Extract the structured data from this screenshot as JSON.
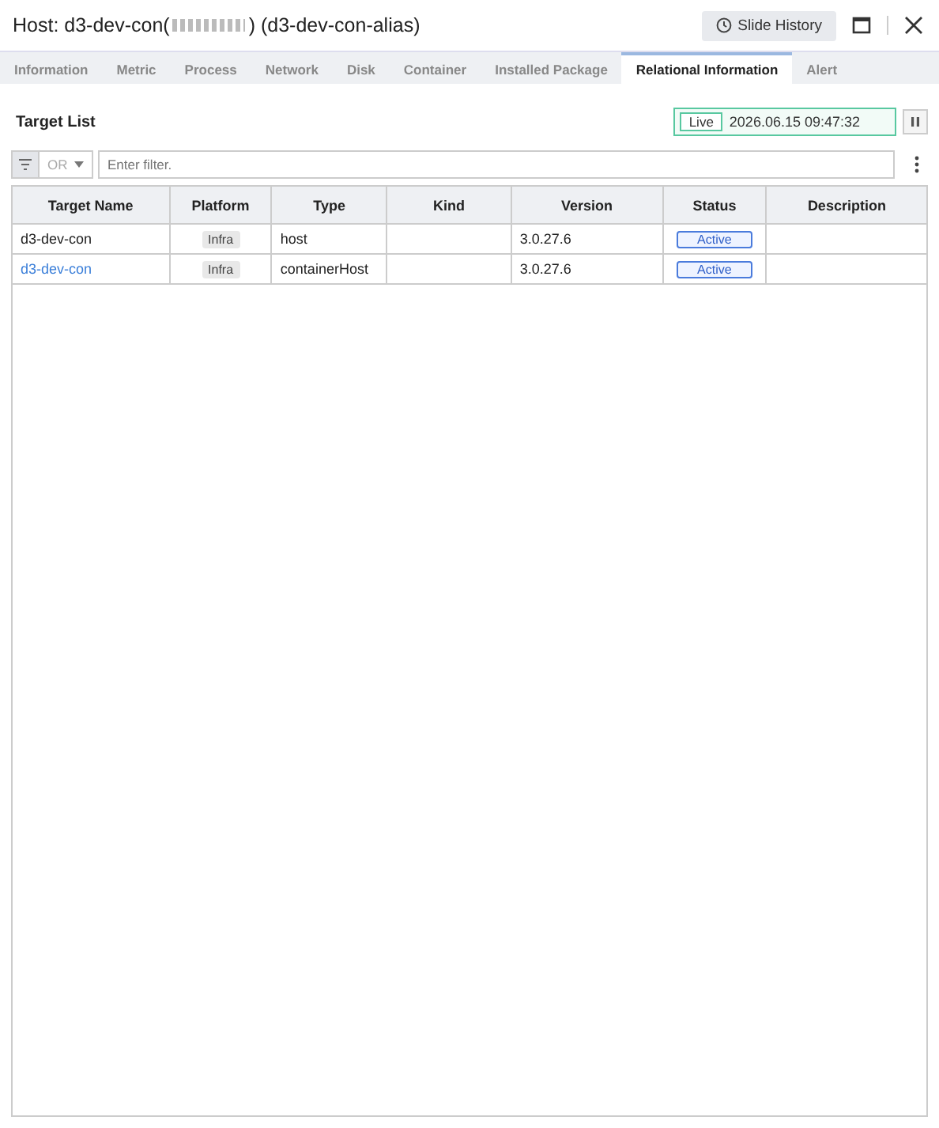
{
  "window": {
    "title_start": "Host: d3-dev-con(",
    "title_end": ") (d3-dev-con-alias)",
    "history_button": "Slide History"
  },
  "tabs": [
    {
      "label": "Information",
      "selected": false
    },
    {
      "label": "Metric",
      "selected": false
    },
    {
      "label": "Process",
      "selected": false
    },
    {
      "label": "Network",
      "selected": false
    },
    {
      "label": "Disk",
      "selected": false
    },
    {
      "label": "Container",
      "selected": false
    },
    {
      "label": "Installed Package",
      "selected": false
    },
    {
      "label": "Relational Information",
      "selected": true
    },
    {
      "label": "Alert",
      "selected": false
    }
  ],
  "section_title": "Target List",
  "live": {
    "badge": "Live",
    "time": "2026.06.15 09:47:32"
  },
  "filter": {
    "operator": "OR",
    "placeholder": "Enter filter."
  },
  "table": {
    "columns": [
      "Target Name",
      "Platform",
      "Type",
      "Kind",
      "Version",
      "Status",
      "Description"
    ],
    "rows": [
      {
        "name": "d3-dev-con",
        "link": false,
        "platform": "Infra",
        "type": "host",
        "kind": "",
        "version": "3.0.27.6",
        "status": "Active"
      },
      {
        "name": "d3-dev-con",
        "link": true,
        "platform": "Infra",
        "type": "containerHost",
        "kind": "",
        "version": "3.0.27.6",
        "status": "Active"
      }
    ]
  }
}
